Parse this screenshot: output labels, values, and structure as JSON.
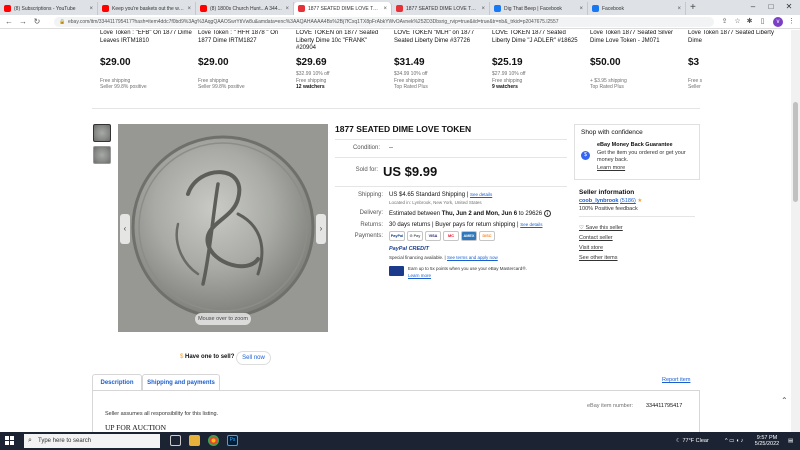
{
  "browser": {
    "tabs": [
      {
        "label": "(8) Subscriptions - YouTube",
        "color": "#ff0000"
      },
      {
        "label": "Keep you're baskets out the wa...",
        "color": "#ff0000"
      },
      {
        "label": "(8) 1800s Church Hunt...A 344...",
        "color": "#ff0000"
      },
      {
        "label": "1877 SEATED DIME LOVE TOKEN",
        "color": "#e53238",
        "active": true
      },
      {
        "label": "1877 SEATED DIME LOVE TOKEN",
        "color": "#e53238"
      },
      {
        "label": "Dig That Beep | Facebook",
        "color": "#1877f2"
      },
      {
        "label": "Facebook",
        "color": "#1877f2"
      }
    ],
    "new_tab": "+",
    "url": "ebay.com/itm/334411795417?hash=item4ddc7f0bd9%3Ag%3AqgQAAOSwrYtiVw8u&amdata=enc%3AAQAHAAAA4Bs%2Bj7fCxq1TX8pFrAbkYWvOAvnek%252D3Dbsrig_rvip=true&iid=true&tr=nb&_trkid=p2047675.l2557",
    "profile_initial": "v"
  },
  "similar_items": [
    {
      "title": "Love Token : \"EFB\" On 1877 Dime Leaves IRTM1810",
      "price": "$29.00",
      "orig": "",
      "ship": "Free shipping",
      "extra": "Seller 99.8% positive",
      "bold": false
    },
    {
      "title": "Love Token : \" HFR 1878 \" On 1877 Dime IRTM1827",
      "price": "$29.00",
      "orig": "",
      "ship": "Free shipping",
      "extra": "Seller 99.8% positive",
      "bold": false
    },
    {
      "title": "LOVE TOKEN on 1877 Seated Liberty Dime 10c \"FRANK\" #20904",
      "price": "$29.69",
      "orig": "$32.99 10% off",
      "ship": "Free shipping",
      "extra": "12 watchers",
      "bold": true
    },
    {
      "title": "LOVE TOKEN \"MLH\" on 1877 Seated Liberty Dime #37726",
      "price": "$31.49",
      "orig": "$34.99 10% off",
      "ship": "Free shipping",
      "extra": "Top Rated Plus",
      "bold": false
    },
    {
      "title": "LOVE TOKEN 1877 Seated Liberty Dime \"J ADLER\" #18625",
      "price": "$25.19",
      "orig": "$27.99 10% off",
      "ship": "Free shipping",
      "extra": "9 watchers",
      "bold": true
    },
    {
      "title": "Love Token 1877 Seated Silver Dime Love Token - JM071",
      "price": "$50.00",
      "orig": "",
      "ship": "+ $3.95 shipping",
      "extra": "Top Rated Plus",
      "bold": false
    },
    {
      "title": "Love Token 1877 Seated Liberty Dime",
      "price": "$3",
      "orig": "",
      "ship": "Free s",
      "extra": "Seller",
      "bold": false
    }
  ],
  "gallery": {
    "zoom_label": "Mouse over to zoom",
    "prev": "‹",
    "next": "›"
  },
  "item": {
    "title": "1877 SEATED DIME LOVE TOKEN",
    "condition_label": "Condition:",
    "condition_value": "--",
    "soldfor_label": "Sold for:",
    "price": "US $9.99",
    "shipping_label": "Shipping:",
    "shipping_value": "US $4.65 Standard Shipping |",
    "shipping_link": "See details",
    "location": "Located in: Lynbrook, New York, United States",
    "delivery_label": "Delivery:",
    "delivery_prefix": "Estimated between",
    "delivery_dates": "Thu, Jun 2 and Mon, Jun 6",
    "delivery_suffix": "to 29626",
    "returns_label": "Returns:",
    "returns_value": "30 days returns | Buyer pays for return shipping |",
    "returns_link": "See details",
    "payments_label": "Payments:",
    "payment_methods": [
      "PayPal",
      "G Pay",
      "VISA",
      "MC",
      "AMEX",
      "DISC"
    ],
    "paypal_credit": "PayPal CREDIT",
    "financing": "Special financing available. |",
    "financing_link": "See terms and apply now",
    "points": "Earn up to 5x points when you use your eBay Mastercard®.",
    "points_link": "Learn more"
  },
  "confidence": {
    "title": "Shop with confidence",
    "guarantee_title": "eBay Money Back Guarantee",
    "guarantee_text": "Get the item you ordered or get your money back.",
    "learn_more": "Learn more"
  },
  "seller": {
    "title": "Seller information",
    "name": "coob_lynbrook",
    "score": "(5186)",
    "feedback": "100% Positive feedback",
    "save": "Save this seller",
    "contact": "Contact seller",
    "visit": "Visit store",
    "other": "See other items"
  },
  "bottom": {
    "sell_prompt": "Have one to sell?",
    "sell_button": "Sell now",
    "tab_description": "Description",
    "tab_shipping": "Shipping and payments",
    "report": "Report item",
    "disclaimer": "Seller assumes all responsibility for this listing.",
    "item_number_label": "eBay item number:",
    "item_number": "334411795417",
    "auction_heading": "UP FOR AUCTION"
  },
  "taskbar": {
    "search_placeholder": "Type here to search",
    "weather": "77°F  Clear",
    "time": "9:57 PM",
    "date": "5/25/2022"
  }
}
